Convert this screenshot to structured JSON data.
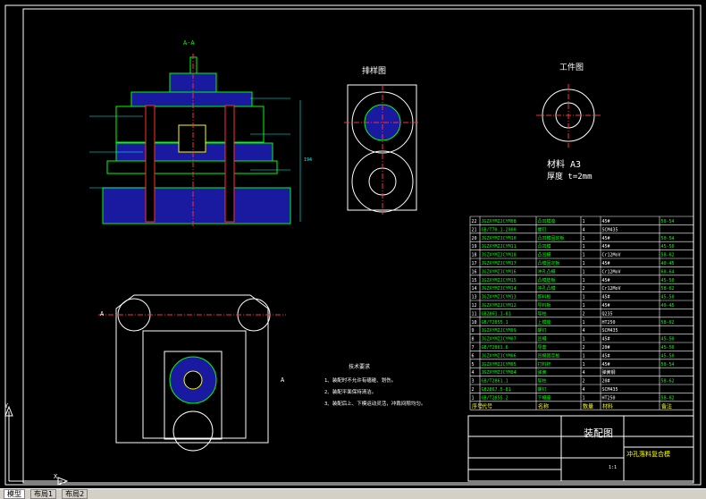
{
  "views": {
    "section_title": "A-A",
    "blank_title": "排样图",
    "workpiece_title": "工件图",
    "material_label": "材料 A3",
    "thickness_label": "厚度 t=2mm",
    "section_mark_left": "A",
    "section_mark_right": "A",
    "height_dim": "194"
  },
  "tech_requirements": {
    "title": "技术要求",
    "items": [
      "1、装配时不允许有磕碰、划伤。",
      "2、装配平面保持清洁。",
      "3、装配后上、下模运动灵活，冲裁间隙均匀。"
    ]
  },
  "bom": {
    "rows": [
      [
        "22",
        "JGZXYMZJCYM08",
        "凸凹模座",
        "1",
        "45#",
        "50-54"
      ],
      [
        "21",
        "GB/T70.1-2000",
        "螺钉",
        "4",
        "SCM435",
        ""
      ],
      [
        "20",
        "JGZXYMZJCYM10",
        "凸凹模固定板",
        "1",
        "45#",
        "50-54"
      ],
      [
        "19",
        "JGZXYMZJCYM11",
        "凸凹模",
        "1",
        "45#",
        "45-50"
      ],
      [
        "18",
        "JGZXYMZJCYM18",
        "凸凹模",
        "1",
        "Cr12MoV",
        "58-62"
      ],
      [
        "17",
        "JGZXYMZJCYM17",
        "凸模固定板",
        "1",
        "45#",
        "40-45"
      ],
      [
        "16",
        "JGZXYMZJCYM16",
        "冲孔凸模",
        "1",
        "Cr12MoV",
        "60-64"
      ],
      [
        "15",
        "JGZXYMZJCYM15",
        "凸模垫板",
        "1",
        "45#",
        "45-50"
      ],
      [
        "14",
        "JGZXYMZJCYM14",
        "冲孔凸模",
        "2",
        "Cr12MoV",
        "58-62"
      ],
      [
        "13",
        "JGZXYMZJCYM13",
        "卸料板",
        "1",
        "45#",
        "45-50"
      ],
      [
        "12",
        "JGZXYMZJCYM12",
        "导料板",
        "1",
        "45#",
        "40-45"
      ],
      [
        "11",
        "GB2861.1-81",
        "导柱",
        "2",
        "Q235",
        ""
      ],
      [
        "10",
        "GB/T2855.1",
        "上模座",
        "1",
        "HT250",
        "58-62"
      ],
      [
        "9",
        "JGZXYMZJCYM09",
        "螺钉",
        "4",
        "SCM435",
        ""
      ],
      [
        "8",
        "JGZXYMZJCYM07",
        "凹模",
        "1",
        "45#",
        "45-50"
      ],
      [
        "7",
        "GB/T2861.6",
        "导套",
        "2",
        "20#",
        "45-50"
      ],
      [
        "6",
        "JGZXYMZJCYM06",
        "凹模固定板",
        "1",
        "45#",
        "45-50"
      ],
      [
        "5",
        "JGZXYMZJCYM05",
        "打料杆",
        "1",
        "45#",
        "50-54"
      ],
      [
        "4",
        "JGZXYMZJCYM04",
        "弹簧",
        "4",
        "弹簧钢",
        ""
      ],
      [
        "3",
        "GB/T2861.1",
        "导柱",
        "2",
        "20#",
        "58-62"
      ],
      [
        "2",
        "GB2867.5-81",
        "螺钉",
        "4",
        "SCM435",
        ""
      ],
      [
        "1",
        "GB/T2855.2",
        "下模座",
        "1",
        "HT250",
        "58-62"
      ]
    ],
    "header": [
      "序号",
      "代号",
      "名称",
      "数量",
      "材料",
      "备注"
    ]
  },
  "title_block": {
    "drawing_name": "装配图",
    "product_name": "冲孔落料复合模",
    "scale": "1:1"
  },
  "status_tabs": [
    "模型",
    "布局1",
    "布局2"
  ],
  "chart_colors": {
    "frame": "#ffffff",
    "green": "#00ff00",
    "cyan": "#00ffff",
    "blue": "#2020c0",
    "yellow": "#ffff00",
    "red": "#ff3030",
    "magenta": "#ff00ff"
  }
}
